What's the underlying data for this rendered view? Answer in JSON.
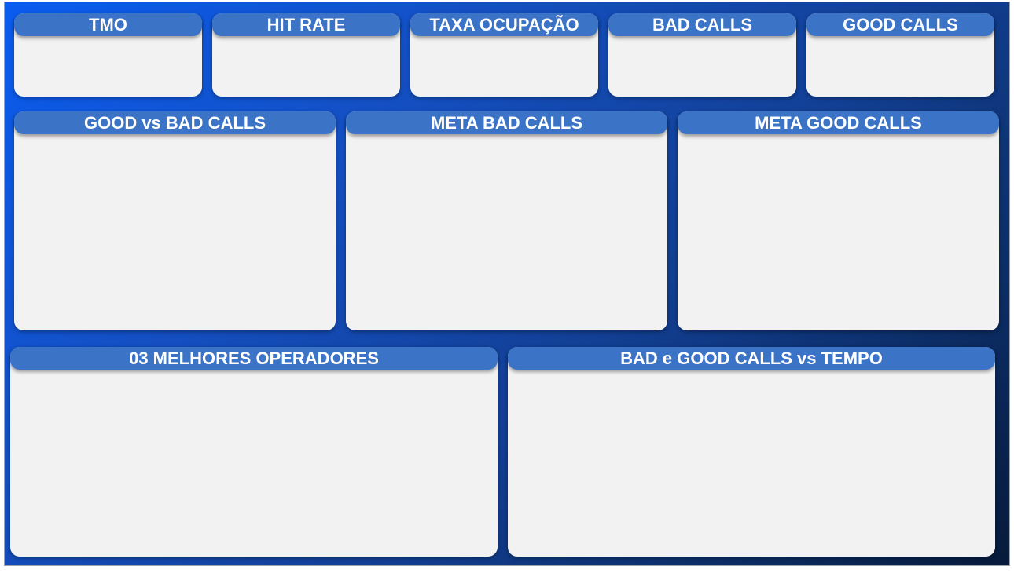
{
  "kpis": [
    {
      "title": "TMO"
    },
    {
      "title": "HIT RATE"
    },
    {
      "title": "TAXA OCUPAÇÃO"
    },
    {
      "title": "BAD CALLS"
    },
    {
      "title": "GOOD CALLS"
    }
  ],
  "middle": [
    {
      "title": "GOOD vs BAD CALLS"
    },
    {
      "title": "META BAD CALLS"
    },
    {
      "title": "META GOOD CALLS"
    }
  ],
  "bottom": [
    {
      "title": "03 MELHORES OPERADORES"
    },
    {
      "title": "BAD e GOOD CALLS vs TEMPO"
    }
  ],
  "colors": {
    "header": "#3b73c6",
    "card": "#f2f2f2",
    "background_start": "#0a5cf0",
    "background_end": "#071a3a"
  }
}
